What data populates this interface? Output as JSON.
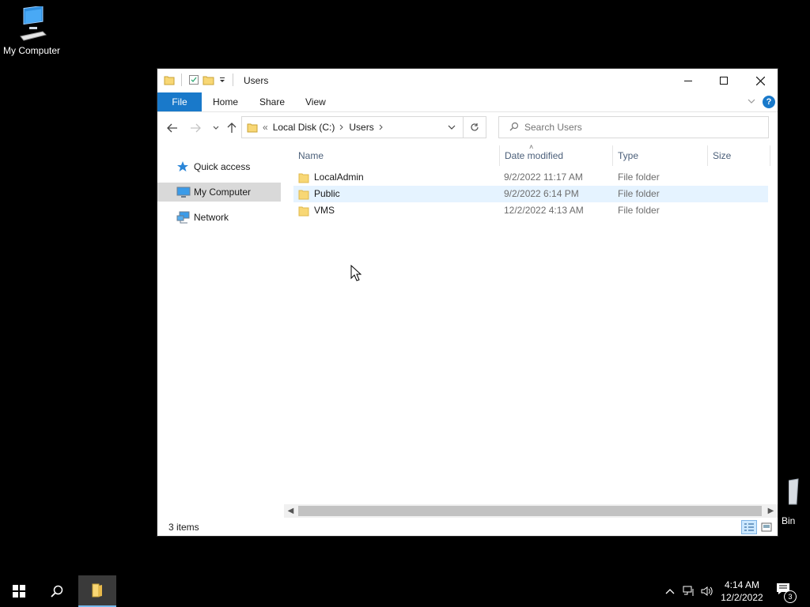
{
  "desktop": {
    "my_computer_label": "My Computer",
    "recycle_bin_label": "Bin"
  },
  "window": {
    "title": "Users",
    "ribbon_tabs": [
      "File",
      "Home",
      "Share",
      "View"
    ],
    "help_label": "?"
  },
  "navigation": {
    "breadcrumb_overflow": "«",
    "breadcrumbs": [
      "Local Disk (C:)",
      "Users"
    ],
    "search_placeholder": "Search Users"
  },
  "nav_pane": {
    "items": [
      "Quick access",
      "My Computer",
      "Network"
    ],
    "selected": "My Computer"
  },
  "file_list": {
    "columns": [
      "Name",
      "Date modified",
      "Type",
      "Size"
    ],
    "rows": [
      {
        "name": "LocalAdmin",
        "date": "9/2/2022 11:17 AM",
        "type": "File folder",
        "size": ""
      },
      {
        "name": "Public",
        "date": "9/2/2022 6:14 PM",
        "type": "File folder",
        "size": ""
      },
      {
        "name": "VMS",
        "date": "12/2/2022 4:13 AM",
        "type": "File folder",
        "size": ""
      }
    ],
    "hovered_row": "Public"
  },
  "status": {
    "item_count": "3 items"
  },
  "taskbar": {
    "time": "4:14 AM",
    "date": "12/2/2022",
    "notification_count": "3"
  },
  "colors": {
    "accent": "#1979ca",
    "selection": "#d9d9d9",
    "hover_row": "#e5f3ff",
    "folder": "#f8d775"
  }
}
